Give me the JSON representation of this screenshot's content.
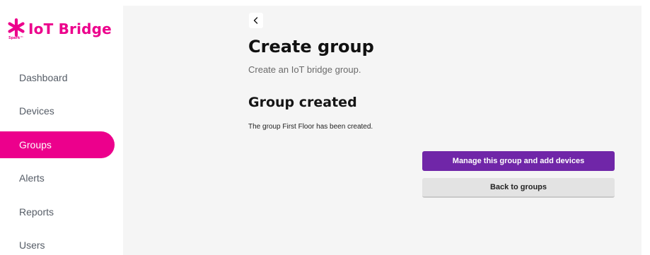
{
  "brand": {
    "title": "IoT Bridge",
    "sub": "Spark™",
    "color": "#ec008c",
    "icon": "spark-star-icon"
  },
  "nav": {
    "items": [
      {
        "label": "Dashboard",
        "active": false
      },
      {
        "label": "Devices",
        "active": false
      },
      {
        "label": "Groups",
        "active": true
      },
      {
        "label": "Alerts",
        "active": false
      },
      {
        "label": "Reports",
        "active": false
      },
      {
        "label": "Users",
        "active": false
      }
    ]
  },
  "page": {
    "back_icon": "chevron-left-icon",
    "title": "Create group",
    "subtitle": "Create an IoT bridge group.",
    "section_title": "Group created",
    "message": "The group First Floor has been created."
  },
  "actions": {
    "primary_label": "Manage this group and add devices",
    "secondary_label": "Back to groups",
    "primary_color": "#7026a8"
  }
}
